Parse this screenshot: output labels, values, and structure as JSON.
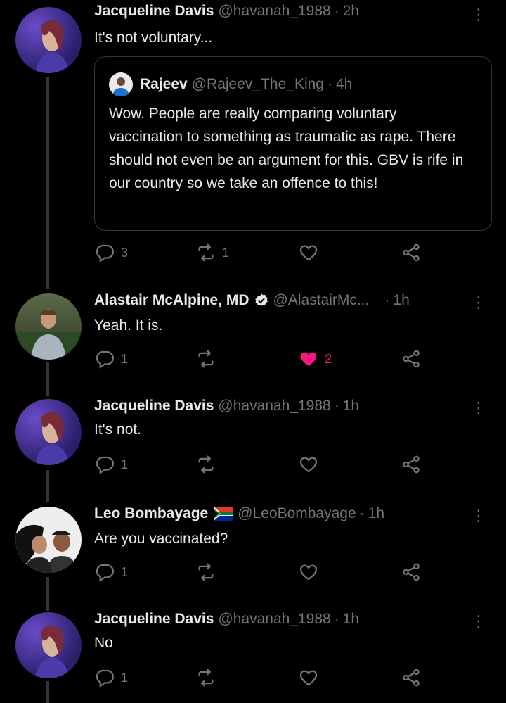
{
  "tweets": [
    {
      "name": "Jacqueline Davis",
      "handle": "@havanah_1988",
      "time": "2h",
      "text": "It's not voluntary...",
      "quote": {
        "name": "Rajeev",
        "handle": "@Rajeev_The_King",
        "time": "4h",
        "text": "Wow. People are really comparing voluntary vaccination to something as traumatic as rape. There should not even be an argument for this. GBV is rife in our country so we take an offence to this!"
      },
      "replies": "3",
      "retweets": "1",
      "likes": ""
    },
    {
      "name": "Alastair McAlpine, MD",
      "handle": "@AlastairMc...",
      "time": "1h",
      "text": "Yeah. It is.",
      "replies": "1",
      "retweets": "",
      "likes": "2",
      "liked": true
    },
    {
      "name": "Jacqueline Davis",
      "handle": "@havanah_1988",
      "time": "1h",
      "text": "It's not.",
      "replies": "1",
      "retweets": "",
      "likes": ""
    },
    {
      "name": "Leo Bombayage",
      "handle": "@LeoBombayage",
      "time": "1h",
      "text": "Are you vaccinated?",
      "replies": "1",
      "retweets": "",
      "likes": ""
    },
    {
      "name": "Jacqueline Davis",
      "handle": "@havanah_1988",
      "time": "1h",
      "text": "No",
      "replies": "1",
      "retweets": "",
      "likes": ""
    }
  ],
  "separator": "·",
  "more_icon": "more-vertical-icon",
  "colors": {
    "background": "#000000",
    "text": "#e7e9ea",
    "muted": "#71767b",
    "like": "#f91880",
    "border": "#333639"
  }
}
